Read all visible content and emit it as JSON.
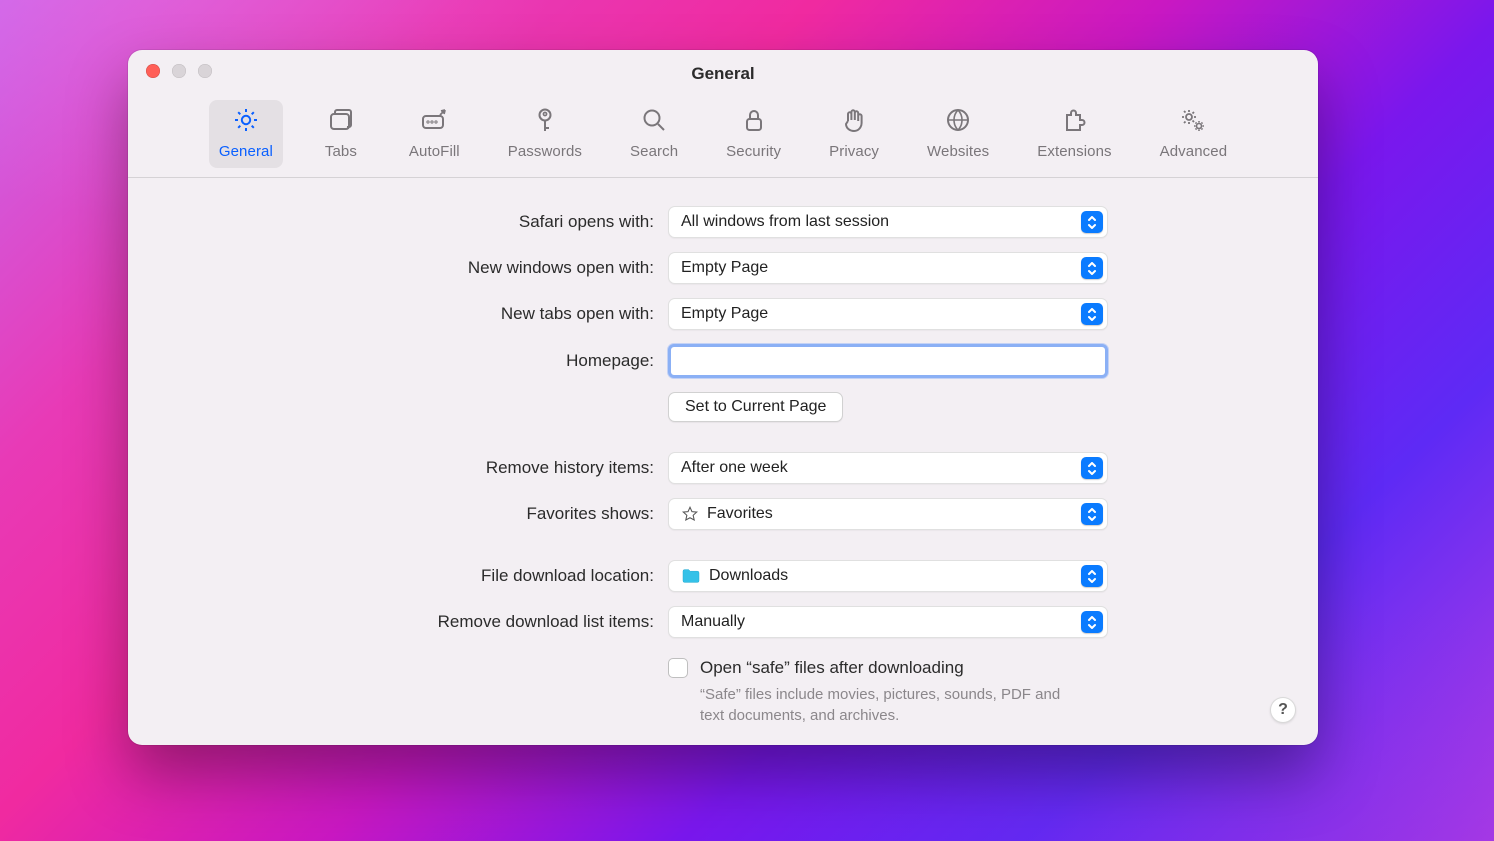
{
  "window": {
    "title": "General"
  },
  "toolbar": {
    "items": [
      {
        "label": "General",
        "icon": "gear",
        "active": true
      },
      {
        "label": "Tabs",
        "icon": "tabs",
        "active": false
      },
      {
        "label": "AutoFill",
        "icon": "autofill",
        "active": false
      },
      {
        "label": "Passwords",
        "icon": "key",
        "active": false
      },
      {
        "label": "Search",
        "icon": "search",
        "active": false
      },
      {
        "label": "Security",
        "icon": "lock",
        "active": false
      },
      {
        "label": "Privacy",
        "icon": "hand",
        "active": false
      },
      {
        "label": "Websites",
        "icon": "globe",
        "active": false
      },
      {
        "label": "Extensions",
        "icon": "puzzle",
        "active": false
      },
      {
        "label": "Advanced",
        "icon": "gears",
        "active": false
      }
    ]
  },
  "form": {
    "opens_with": {
      "label": "Safari opens with:",
      "value": "All windows from last session"
    },
    "new_windows": {
      "label": "New windows open with:",
      "value": "Empty Page"
    },
    "new_tabs": {
      "label": "New tabs open with:",
      "value": "Empty Page"
    },
    "homepage": {
      "label": "Homepage:",
      "value": ""
    },
    "set_current": {
      "label": "Set to Current Page"
    },
    "remove_history": {
      "label": "Remove history items:",
      "value": "After one week"
    },
    "favorites_shows": {
      "label": "Favorites shows:",
      "value": "Favorites"
    },
    "download_loc": {
      "label": "File download location:",
      "value": "Downloads"
    },
    "remove_downloads": {
      "label": "Remove download list items:",
      "value": "Manually"
    },
    "safe_files": {
      "label": "Open “safe” files after downloading",
      "checked": false,
      "help": "“Safe” files include movies, pictures, sounds, PDF and text documents, and archives."
    }
  },
  "help_button": "?"
}
